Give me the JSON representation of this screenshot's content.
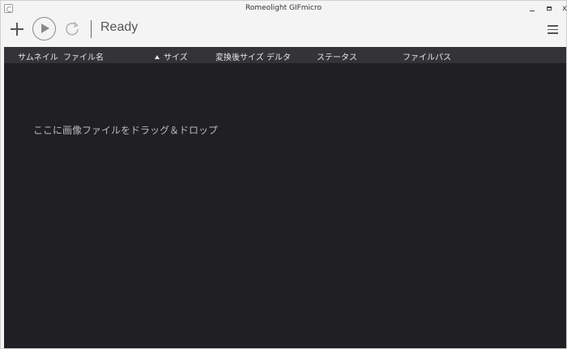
{
  "window": {
    "title": "Romeolight GIFmicro",
    "min_label": "_",
    "close_label": "x"
  },
  "toolbar": {
    "status": "Ready"
  },
  "columns": {
    "thumbnail": "サムネイル",
    "filename": "ファイル名",
    "size": "サイズ",
    "converted_size": "変換後サイズ",
    "delta": "デルタ",
    "status": "ステータス",
    "filepath": "ファイルパス"
  },
  "list": {
    "drop_hint": "ここに画像ファイルをドラッグ＆ドロップ"
  },
  "icons": [
    "app-icon",
    "plus-icon",
    "play-icon",
    "redo-icon",
    "hamburger-menu-icon",
    "sort-ascending-icon"
  ],
  "colors": {
    "header_bg": "#343438",
    "list_bg": "#202024",
    "toolbar_bg": "#f4f4f4"
  }
}
